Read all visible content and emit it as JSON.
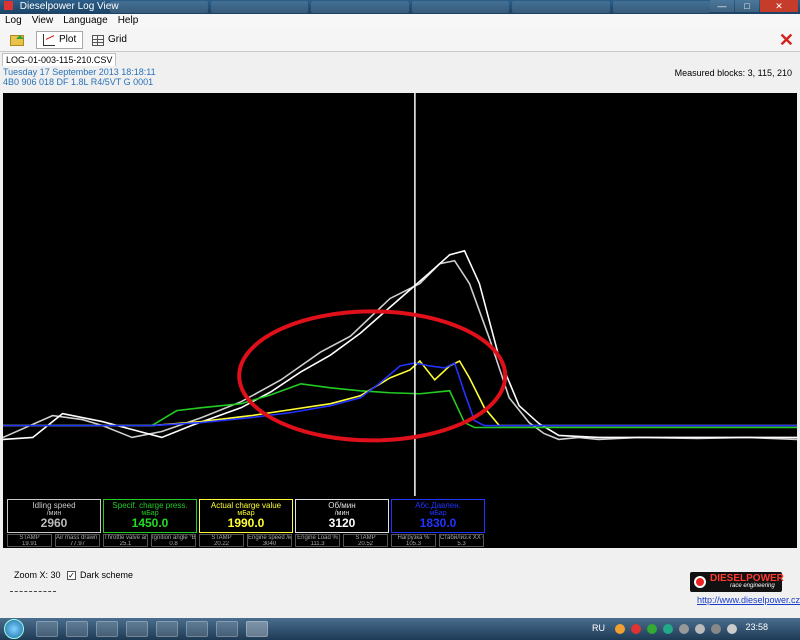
{
  "window": {
    "title": "Dieselpower Log View"
  },
  "menu": [
    "Log",
    "View",
    "Language",
    "Help"
  ],
  "toolbar": {
    "plot_label": "Plot",
    "grid_label": "Grid"
  },
  "file_tab": "LOG-01-003-115-210.CSV",
  "info": {
    "date": "Tuesday 17 September 2013 18:18:11",
    "ecu": "4B0 906 018 DF  1.8L R4/5VT    G   0001",
    "blocks": "Measured blocks: 3, 115, 210"
  },
  "colors": {
    "idle": "#c8c8c8",
    "spec": "#22cc22",
    "actual": "#ffff33",
    "rpm": "#ffffff",
    "abs": "#2233ff",
    "highlight": "#e0101a"
  },
  "chart_data": {
    "type": "line",
    "series": [
      {
        "color": "#cfcfcf",
        "values": [
          [
            0,
            440
          ],
          [
            50,
            418
          ],
          [
            80,
            422
          ],
          [
            100,
            428
          ],
          [
            130,
            440
          ],
          [
            160,
            434
          ],
          [
            200,
            420
          ],
          [
            240,
            404
          ],
          [
            280,
            382
          ],
          [
            320,
            354
          ],
          [
            350,
            338
          ],
          [
            390,
            300
          ],
          [
            420,
            285
          ],
          [
            440,
            265
          ],
          [
            455,
            262
          ],
          [
            470,
            285
          ],
          [
            490,
            340
          ],
          [
            510,
            400
          ],
          [
            530,
            425
          ],
          [
            545,
            436
          ],
          [
            560,
            442
          ],
          [
            580,
            440
          ],
          [
            600,
            442
          ],
          [
            640,
            440
          ],
          [
            700,
            441
          ],
          [
            750,
            440
          ],
          [
            800,
            442
          ]
        ]
      },
      {
        "color": "#ffffff",
        "values": [
          [
            0,
            442
          ],
          [
            30,
            440
          ],
          [
            60,
            416
          ],
          [
            100,
            424
          ],
          [
            130,
            432
          ],
          [
            160,
            440
          ],
          [
            190,
            428
          ],
          [
            240,
            410
          ],
          [
            270,
            394
          ],
          [
            300,
            374
          ],
          [
            330,
            357
          ],
          [
            360,
            335
          ],
          [
            400,
            300
          ],
          [
            430,
            274
          ],
          [
            450,
            256
          ],
          [
            465,
            252
          ],
          [
            480,
            285
          ],
          [
            500,
            360
          ],
          [
            520,
            408
          ],
          [
            540,
            426
          ],
          [
            560,
            438
          ],
          [
            600,
            440
          ],
          [
            700,
            440
          ],
          [
            800,
            440
          ]
        ]
      },
      {
        "color": "#22cc22",
        "values": [
          [
            0,
            428
          ],
          [
            150,
            428
          ],
          [
            175,
            413
          ],
          [
            200,
            410
          ],
          [
            240,
            406
          ],
          [
            270,
            397
          ],
          [
            300,
            386
          ],
          [
            330,
            390
          ],
          [
            360,
            393
          ],
          [
            390,
            395
          ],
          [
            420,
            396
          ],
          [
            450,
            393
          ],
          [
            465,
            425
          ],
          [
            475,
            430
          ],
          [
            800,
            430
          ]
        ]
      },
      {
        "color": "#ffff33",
        "values": [
          [
            0,
            428
          ],
          [
            150,
            428
          ],
          [
            200,
            424
          ],
          [
            250,
            418
          ],
          [
            290,
            412
          ],
          [
            330,
            406
          ],
          [
            360,
            398
          ],
          [
            390,
            380
          ],
          [
            410,
            372
          ],
          [
            420,
            363
          ],
          [
            435,
            382
          ],
          [
            450,
            368
          ],
          [
            460,
            363
          ],
          [
            470,
            380
          ],
          [
            485,
            410
          ],
          [
            500,
            428
          ],
          [
            800,
            428
          ]
        ]
      },
      {
        "color": "#2233ff",
        "values": [
          [
            0,
            428
          ],
          [
            150,
            428
          ],
          [
            200,
            425
          ],
          [
            250,
            420
          ],
          [
            290,
            415
          ],
          [
            330,
            408
          ],
          [
            360,
            400
          ],
          [
            380,
            385
          ],
          [
            400,
            368
          ],
          [
            415,
            365
          ],
          [
            430,
            368
          ],
          [
            445,
            370
          ],
          [
            455,
            365
          ],
          [
            465,
            395
          ],
          [
            475,
            423
          ],
          [
            485,
            428
          ],
          [
            800,
            428
          ]
        ]
      }
    ],
    "cursor_x": 415
  },
  "gauges": [
    {
      "name": "Idling speed",
      "unit": "/мин",
      "value": "2960",
      "color": "#c8c8c8",
      "value_color": "#bbbbbb"
    },
    {
      "name": "Specif. charge press.",
      "unit": "мБар",
      "value": "1450.0",
      "color": "#22cc22",
      "value_color": "#22dd22"
    },
    {
      "name": "Actual charge value",
      "unit": "мБар",
      "value": "1990.0",
      "color": "#ffff33",
      "value_color": "#ffff33"
    },
    {
      "name": "Об/мин",
      "unit": "/мин",
      "value": "3120",
      "color": "#e0e0e0",
      "value_color": "#ffffff"
    },
    {
      "name": "Абс.Давлен.",
      "unit": "мБар",
      "value": "1830.0",
      "color": "#2233ff",
      "value_color": "#2233ff"
    }
  ],
  "small_readouts": [
    {
      "name": "STAMP",
      "value": "19.91"
    },
    {
      "name": "Air mass drawn in...",
      "value": "77.97"
    },
    {
      "name": "Throttle valve angl...",
      "value": "25.1"
    },
    {
      "name": "Ignition angle °BT...",
      "value": "0.8"
    },
    {
      "name": "STAMP",
      "value": "20.22"
    },
    {
      "name": "Engine speed /мин",
      "value": "3040"
    },
    {
      "name": "Engine Load %",
      "value": "111.3"
    },
    {
      "name": "STAMP",
      "value": "20.52"
    },
    {
      "name": "Нагрузка %",
      "value": "105.3"
    },
    {
      "name": "Стабилиз.к ХХ СТ...",
      "value": "5.3"
    }
  ],
  "bottom": {
    "zoom": "Zoom X: 30",
    "dark_scheme": "Dark scheme",
    "logo_main": "DIESELPOWER",
    "logo_sub": "race engineering",
    "url": "http://www.dieselpower.cz"
  },
  "taskbar": {
    "lang": "RU",
    "time": "23:58"
  }
}
